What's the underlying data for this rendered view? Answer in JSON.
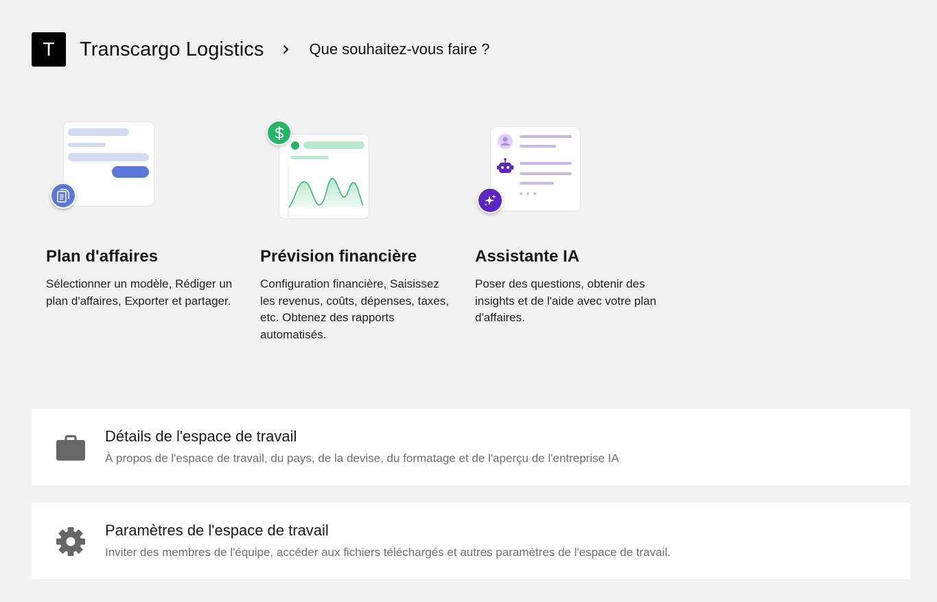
{
  "header": {
    "logo_letter": "T",
    "company": "Transcargo Logistics",
    "prompt": "Que souhaitez-vous faire ?"
  },
  "cards": [
    {
      "title": "Plan d'affaires",
      "description": "Sélectionner un modèle, Rédiger un plan d'affaires, Exporter et partager.",
      "icon": "document-icon",
      "accent": "#5b78d9"
    },
    {
      "title": "Prévision financière",
      "description": "Configuration financière, Saisissez les revenus, coûts, dépenses, taxes, etc. Obtenez des rapports automatisés.",
      "icon": "dollar-icon",
      "accent": "#25b567"
    },
    {
      "title": "Assistante IA",
      "description": "Poser des questions, obtenir des insights et de l'aide avec votre plan d'affaires.",
      "icon": "sparkle-icon",
      "accent": "#5b26c4"
    }
  ],
  "panels": [
    {
      "title": "Détails de l'espace de travail",
      "description": "À propos de l'espace de travail, du pays, de la devise, du formatage et de l'aperçu de l'entreprise IA",
      "icon": "briefcase-icon"
    },
    {
      "title": "Paramètres de l'espace de travail",
      "description": "Inviter des membres de l'équipe, accéder aux fichiers téléchargés et autres paramètres de l'espace de travail.",
      "icon": "gear-icon"
    }
  ]
}
